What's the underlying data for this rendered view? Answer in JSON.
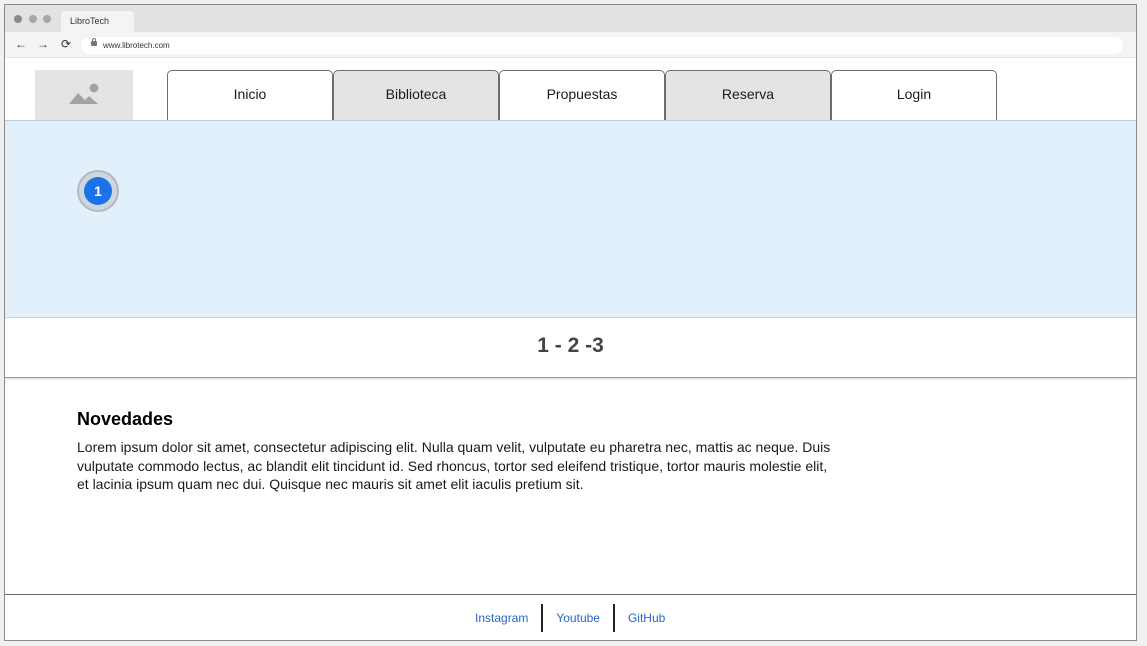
{
  "browser": {
    "tab_title": "LibroTech",
    "url": "www.librotech.com",
    "back_icon": "←",
    "forward_icon": "→",
    "reload_icon": "⟳"
  },
  "header": {
    "logo_icon": "image-placeholder-icon",
    "nav": [
      "Inicio",
      "Biblioteca",
      "Propuestas",
      "Reserva",
      "Login"
    ]
  },
  "carousel": {
    "badge_number": "1",
    "pager_text": "1 - 2 -3"
  },
  "news": {
    "title": "Novedades",
    "lines": [
      "Lorem ipsum dolor sit amet, consectetur adipiscing elit. Nulla quam velit, vulputate eu pharetra nec, mattis ac neque. Duis",
      "vulputate commodo lectus, ac blandit elit tincidunt id. Sed rhoncus, tortor sed eleifend tristique, tortor mauris molestie elit,",
      "et lacinia ipsum quam nec dui. Quisque nec mauris sit amet elit iaculis pretium sit."
    ]
  },
  "footer": {
    "links": [
      "Instagram",
      "Youtube",
      "GitHub"
    ]
  },
  "colors": {
    "accent": "#1a73e8",
    "carousel_bg": "#e2f0fc",
    "link": "#2a66c9"
  }
}
